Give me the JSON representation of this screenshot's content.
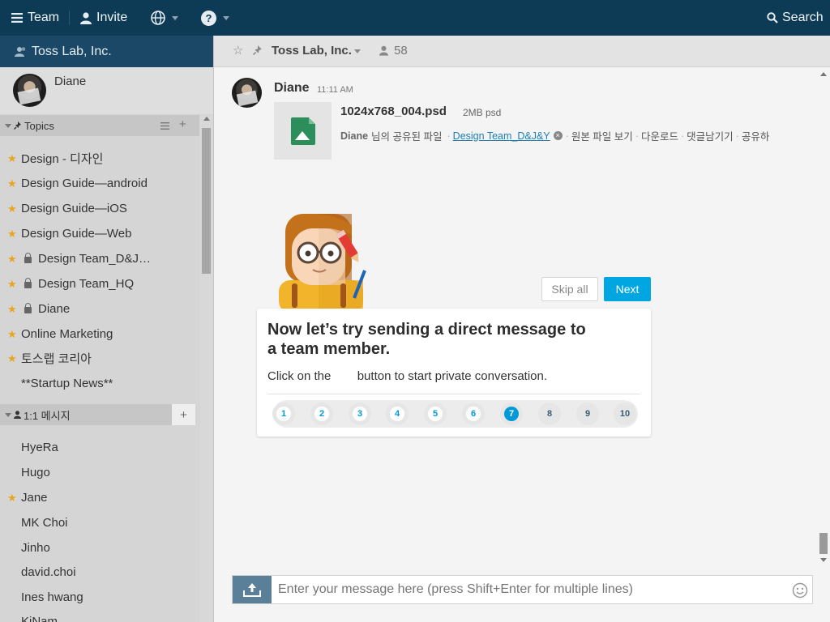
{
  "topbar": {
    "team_label": "Team",
    "invite_label": "Invite",
    "search_label": "Search"
  },
  "sidebar": {
    "team_name": "Toss Lab, Inc.",
    "profile_name": "Diane",
    "topics_header": "Topics",
    "topics": [
      {
        "label": "Design - 디자인",
        "starred": true,
        "locked": false
      },
      {
        "label": "Design Guide—android",
        "starred": true,
        "locked": false
      },
      {
        "label": "Design Guide—iOS",
        "starred": true,
        "locked": false
      },
      {
        "label": "Design Guide—Web",
        "starred": true,
        "locked": false
      },
      {
        "label": "Design Team_D&J…",
        "starred": true,
        "locked": true
      },
      {
        "label": "Design Team_HQ",
        "starred": true,
        "locked": true
      },
      {
        "label": "Diane",
        "starred": true,
        "locked": true
      },
      {
        "label": "Online Marketing",
        "starred": true,
        "locked": false
      },
      {
        "label": "토스랩 코리아",
        "starred": true,
        "locked": false
      },
      {
        "label": "**Startup News**",
        "starred": false,
        "locked": false
      }
    ],
    "dm_header": "1:1 메시지",
    "dms": [
      {
        "label": "HyeRa",
        "starred": false
      },
      {
        "label": "Hugo",
        "starred": false
      },
      {
        "label": "Jane",
        "starred": true
      },
      {
        "label": "MK Choi",
        "starred": false
      },
      {
        "label": "Jinho",
        "starred": false
      },
      {
        "label": "david.choi",
        "starred": false
      },
      {
        "label": "Ines hwang",
        "starred": false
      },
      {
        "label": "KiNam",
        "starred": false
      }
    ]
  },
  "channel": {
    "name": "Toss Lab, Inc.",
    "member_count": "58"
  },
  "message": {
    "author": "Diane",
    "time": "11:11 AM",
    "file_name": "1024x768_004.psd",
    "file_meta": "2MB psd",
    "shared_by": "Diane",
    "shared_text": "님의 공유된 파일",
    "shared_topic": "Design Team_D&J&Y",
    "actions": [
      "원본 파일 보기",
      "다운로드",
      "댓글남기기",
      "공유하"
    ]
  },
  "composer": {
    "placeholder": "Enter your message here (press Shift+Enter for multiple lines)"
  },
  "tutorial": {
    "title_line1": "Now let’s try sending a direct message to",
    "title_line2": "a team member.",
    "body_before": "Click on the",
    "body_after": "button to start private conversation.",
    "skip_label": "Skip all",
    "next_label": "Next",
    "steps": [
      "1",
      "2",
      "3",
      "4",
      "5",
      "6",
      "7",
      "8",
      "9",
      "10"
    ],
    "current_step": 7
  },
  "colors": {
    "topbar": "#0d3a55",
    "accent": "#00a6e2",
    "star": "#e9a51c"
  }
}
